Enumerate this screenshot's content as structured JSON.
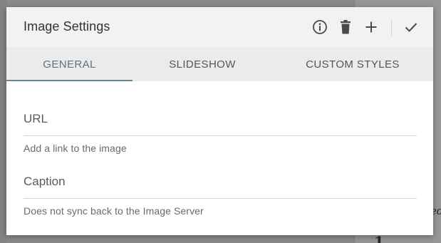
{
  "dialog": {
    "title": "Image Settings",
    "actions": {
      "info_icon": "info-icon",
      "delete_icon": "trash-icon",
      "add_icon": "plus-icon",
      "confirm_icon": "check-icon"
    }
  },
  "tabs": [
    {
      "label": "GENERAL",
      "active": true
    },
    {
      "label": "SLIDESHOW",
      "active": false
    },
    {
      "label": "CUSTOM STYLES",
      "active": false
    }
  ],
  "fields": {
    "url": {
      "label": "URL",
      "value": "",
      "help": "Add a link to the image"
    },
    "caption": {
      "label": "Caption",
      "value": "",
      "help": "Does not sync back to the Image Server"
    }
  },
  "colors": {
    "accent": "#6a8794",
    "header_bg": "#f2f2f2",
    "tabs_bg": "#ebebeb",
    "backdrop": "#8d8d8d"
  }
}
